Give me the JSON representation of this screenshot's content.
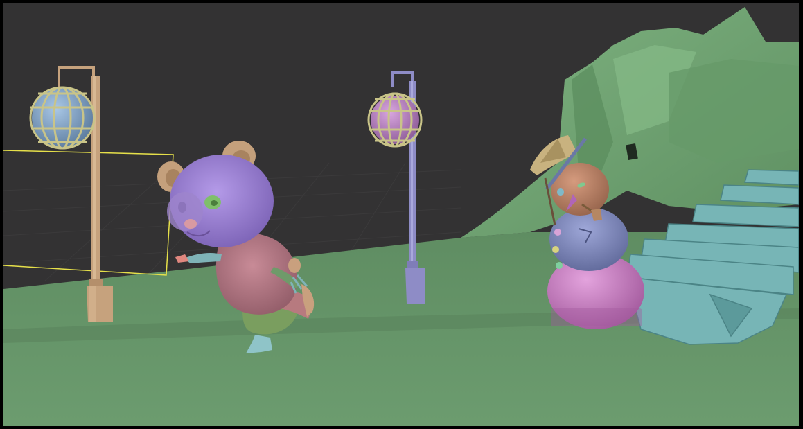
{
  "viewport": {
    "scene": "3d-modeling-viewport",
    "background_color": "#333233",
    "ground_color": "#6b9a6e",
    "selection_outline_color": "#e6e04a"
  },
  "objects": [
    {
      "id": "lamp-post-left",
      "icon": "lamp-post",
      "color": "#c6a27d"
    },
    {
      "id": "lamp-post-center",
      "icon": "lamp-post",
      "color": "#8e8cc6"
    },
    {
      "id": "bear-character",
      "icon": "bear",
      "color": "#9a7fd0"
    },
    {
      "id": "snowman",
      "icon": "snowman",
      "color": "#c47cc0"
    },
    {
      "id": "stairs",
      "icon": "stairs",
      "color": "#7fbdbd"
    },
    {
      "id": "hill",
      "icon": "hill",
      "color": "#6ea070"
    }
  ]
}
